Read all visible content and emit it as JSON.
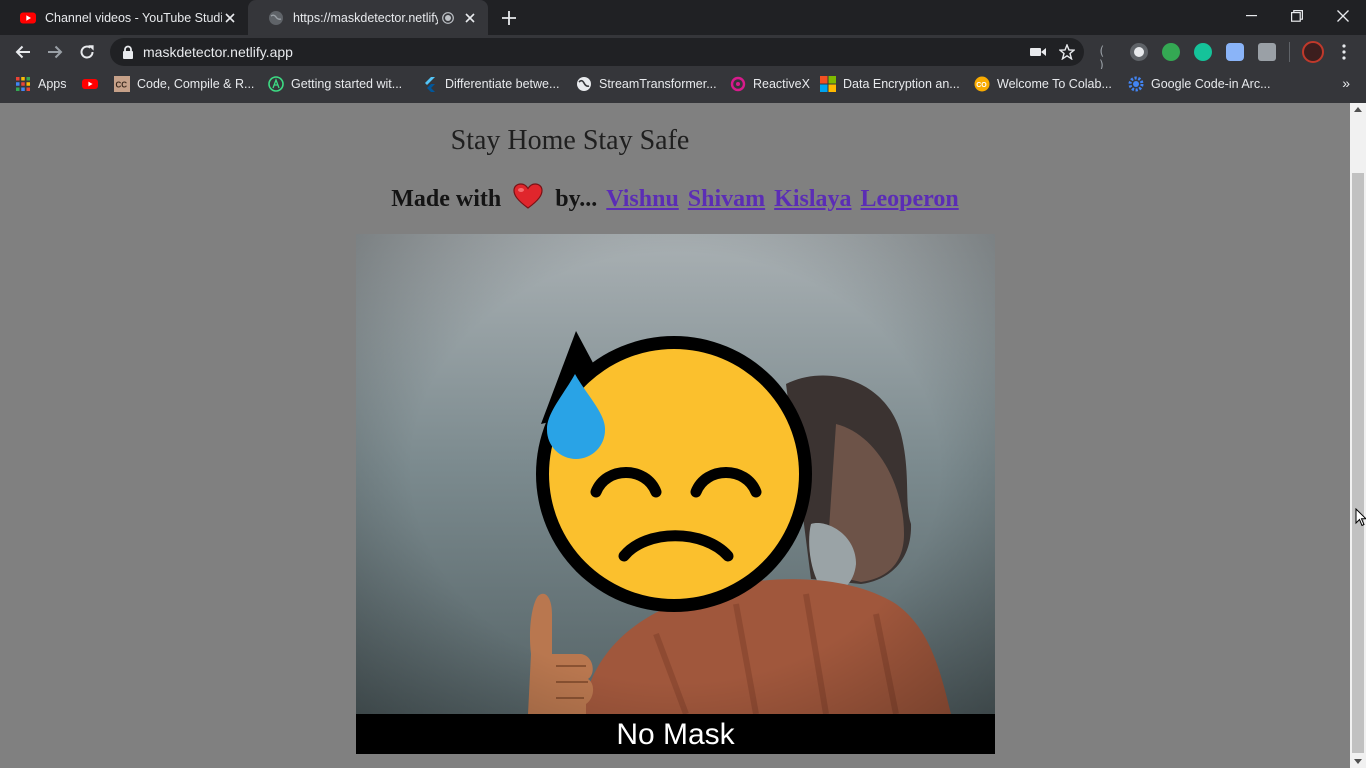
{
  "browser": {
    "tabs": [
      {
        "title": "Channel videos - YouTube Studio",
        "active": false
      },
      {
        "title": "https://maskdetector.netlify.app",
        "active": true
      }
    ],
    "address": "maskdetector.netlify.app",
    "bookmarks": [
      {
        "label": "Apps",
        "icon": "apps-grid-icon"
      },
      {
        "label": "",
        "icon": "youtube-icon"
      },
      {
        "label": "Code, Compile & R...",
        "icon": "cc-icon"
      },
      {
        "label": "Getting started wit...",
        "icon": "android-studio-icon"
      },
      {
        "label": "Differentiate betwe...",
        "icon": "flutter-icon"
      },
      {
        "label": "StreamTransformer...",
        "icon": "globe-icon"
      },
      {
        "label": "ReactiveX",
        "icon": "reactivex-icon"
      },
      {
        "label": "Data Encryption an...",
        "icon": "microsoft-icon"
      },
      {
        "label": "Welcome To Colab...",
        "icon": "colab-icon"
      },
      {
        "label": "Google Code-in Arc...",
        "icon": "gear-icon"
      }
    ],
    "bookmarks_more": "»"
  },
  "page": {
    "heading": "Stay Home Stay Safe",
    "credits_prefix": "Made with",
    "credits_by": "by...",
    "authors": [
      "Vishnu",
      "Shivam",
      "Kislaya",
      "Leoperon"
    ],
    "video_caption": "No Mask"
  },
  "colors": {
    "page_background": "#808080",
    "link": "#5b2db5",
    "emoji_face": "#fbc02d",
    "emoji_drop": "#29a3e6"
  }
}
